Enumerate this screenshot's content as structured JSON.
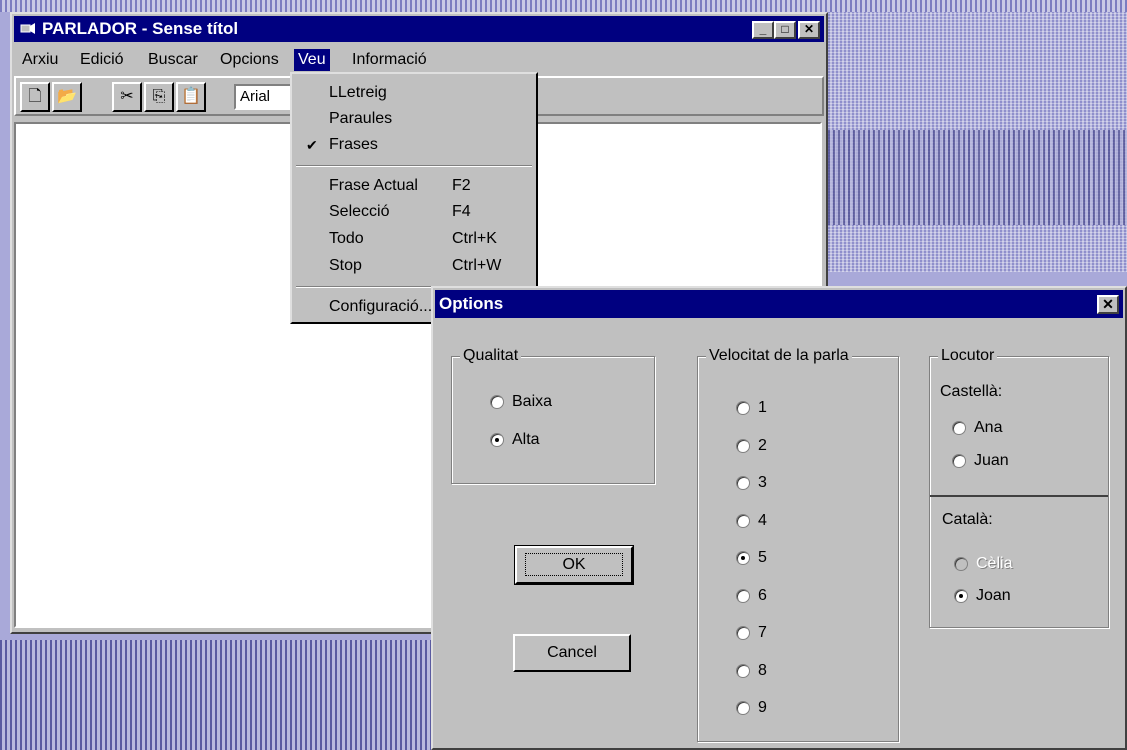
{
  "window": {
    "title": "PARLADOR - Sense títol",
    "menu": [
      "Arxiu",
      "Edició",
      "Buscar",
      "Opcions",
      "Veu",
      "Informació"
    ],
    "active_menu": "Veu",
    "font_field": "Arial"
  },
  "dropdown": {
    "items": [
      {
        "label": "LLetreig",
        "shortcut": "",
        "checked": false
      },
      {
        "label": "Paraules",
        "shortcut": "",
        "checked": false
      },
      {
        "label": "Frases",
        "shortcut": "",
        "checked": true
      },
      {
        "label": "Frase Actual",
        "shortcut": "F2",
        "checked": false
      },
      {
        "label": "Selecció",
        "shortcut": "F4",
        "checked": false
      },
      {
        "label": "Todo",
        "shortcut": "Ctrl+K",
        "checked": false
      },
      {
        "label": "Stop",
        "shortcut": "Ctrl+W",
        "checked": false
      },
      {
        "label": "Configuració...",
        "shortcut": "",
        "checked": false
      }
    ],
    "check_glyph": "✔"
  },
  "dialog": {
    "title": "Options",
    "quality": {
      "label": "Qualitat",
      "options": [
        "Baixa",
        "Alta"
      ],
      "selected": "Alta"
    },
    "speed": {
      "label": "Velocitat de la parla",
      "options": [
        "1",
        "2",
        "3",
        "4",
        "5",
        "6",
        "7",
        "8",
        "9"
      ],
      "selected": "5"
    },
    "speaker": {
      "label": "Locutor",
      "castellano": {
        "label": "Castellà:",
        "options": [
          "Ana",
          "Juan"
        ],
        "selected": ""
      },
      "catala": {
        "label": "Català:",
        "options": [
          "Cèlia",
          "Joan"
        ],
        "selected": "Joan",
        "disabled": [
          "Cèlia"
        ]
      }
    },
    "ok_label": "OK",
    "cancel_label": "Cancel"
  }
}
